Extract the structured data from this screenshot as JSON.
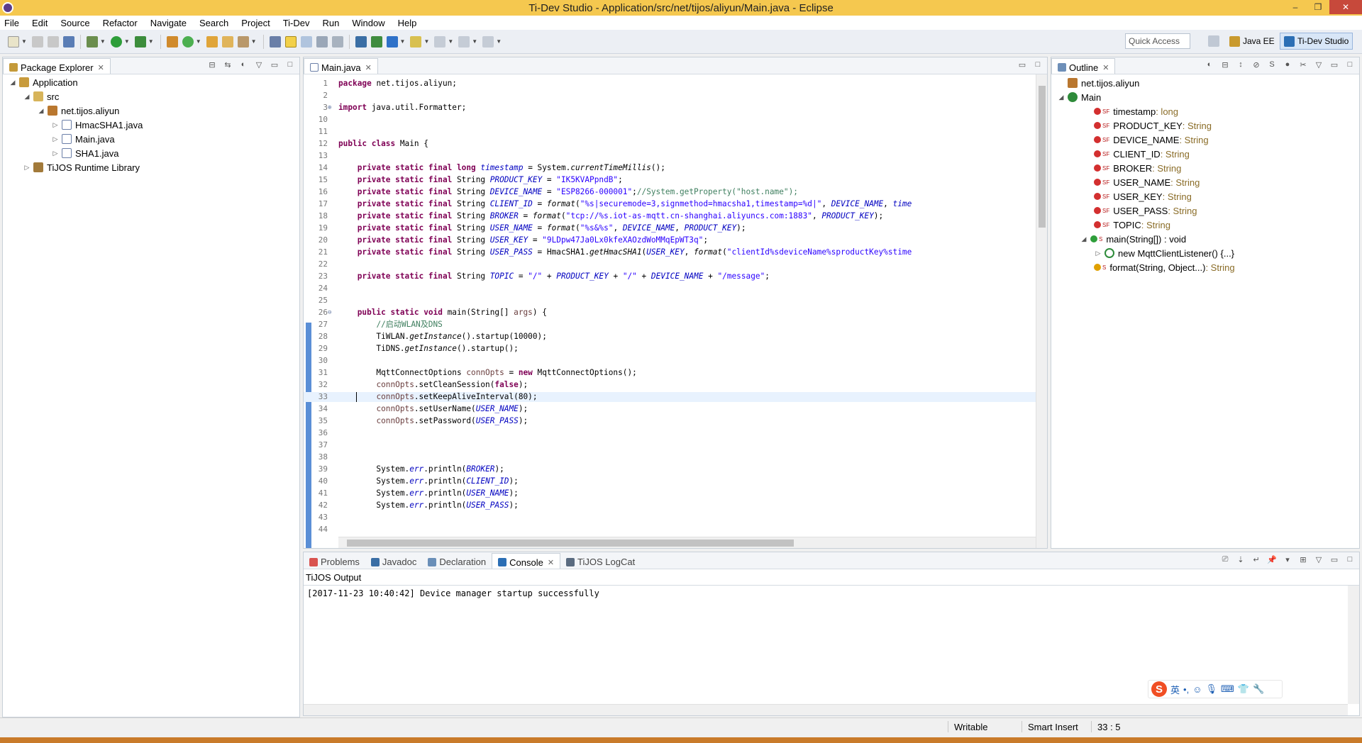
{
  "window": {
    "title": "Ti-Dev Studio - Application/src/net/tijos/aliyun/Main.java - Eclipse",
    "minimize": "–",
    "maximize": "❐",
    "close": "✕"
  },
  "menu": [
    "File",
    "Edit",
    "Source",
    "Refactor",
    "Navigate",
    "Search",
    "Project",
    "Ti-Dev",
    "Run",
    "Window",
    "Help"
  ],
  "toolbar": {
    "quick_access": "Quick Access",
    "perspectives": [
      "Java EE",
      "Ti-Dev Studio"
    ]
  },
  "package_explorer": {
    "tab": "Package Explorer",
    "items": [
      {
        "label": "Application",
        "expanded": true,
        "icon": "project-icon"
      },
      {
        "label": "src",
        "expanded": true,
        "icon": "source-folder-icon"
      },
      {
        "label": "net.tijos.aliyun",
        "expanded": true,
        "icon": "package-icon"
      },
      {
        "label": "HmacSHA1.java",
        "expanded": false,
        "icon": "java-file-icon"
      },
      {
        "label": "Main.java",
        "expanded": false,
        "icon": "java-file-icon"
      },
      {
        "label": "SHA1.java",
        "expanded": false,
        "icon": "java-file-icon"
      },
      {
        "label": "TiJOS Runtime Library",
        "expanded": false,
        "icon": "library-icon"
      }
    ]
  },
  "editor": {
    "tab": "Main.java",
    "cursor_line": "33",
    "lines": [
      {
        "n": "1",
        "html": "<span class=\"kw\">package</span> net.tijos.aliyun;"
      },
      {
        "n": "2",
        "html": ""
      },
      {
        "n": "3",
        "html": "<span class=\"kw\">import</span> java.util.Formatter;",
        "fold": "⊕"
      },
      {
        "n": "10",
        "html": ""
      },
      {
        "n": "11",
        "html": ""
      },
      {
        "n": "12",
        "html": "<span class=\"kw\">public class</span> Main {"
      },
      {
        "n": "13",
        "html": ""
      },
      {
        "n": "14",
        "html": "    <span class=\"kw\">private static final long</span> <span class=\"fld\">timestamp</span> = System.<span class=\"mi\">currentTimeMillis</span>();"
      },
      {
        "n": "15",
        "html": "    <span class=\"kw\">private static final</span> String <span class=\"fld\">PRODUCT_KEY</span> = <span class=\"str\">\"IK5KVAPpndB\"</span>;"
      },
      {
        "n": "16",
        "html": "    <span class=\"kw\">private static final</span> String <span class=\"fld\">DEVICE_NAME</span> = <span class=\"str\">\"ESP8266-000001\"</span>;<span class=\"cmt\">//System.getProperty(\"host.name\");</span>"
      },
      {
        "n": "17",
        "html": "    <span class=\"kw\">private static final</span> String <span class=\"fld\">CLIENT_ID</span> = <span class=\"mi\">format</span>(<span class=\"str\">\"%s|securemode=3,signmethod=hmacsha1,timestamp=%d|\"</span>, <span class=\"fld\">DEVICE_NAME</span>, <span class=\"fld\">time</span>"
      },
      {
        "n": "18",
        "html": "    <span class=\"kw\">private static final</span> String <span class=\"fld\">BROKER</span> = <span class=\"mi\">format</span>(<span class=\"str\">\"tcp://%s.iot-as-mqtt.cn-shanghai.aliyuncs.com:1883\"</span>, <span class=\"fld\">PRODUCT_KEY</span>);"
      },
      {
        "n": "19",
        "html": "    <span class=\"kw\">private static final</span> String <span class=\"fld\">USER_NAME</span> = <span class=\"mi\">format</span>(<span class=\"str\">\"%s&amp;%s\"</span>, <span class=\"fld\">DEVICE_NAME</span>, <span class=\"fld\">PRODUCT_KEY</span>);"
      },
      {
        "n": "20",
        "html": "    <span class=\"kw\">private static final</span> String <span class=\"fld\">USER_KEY</span> = <span class=\"str\">\"9LDpw47Ja0Lx0kfeXAOzdWoMMqEpWT3q\"</span>;"
      },
      {
        "n": "21",
        "html": "    <span class=\"kw\">private static final</span> String <span class=\"fld\">USER_PASS</span> = HmacSHA1.<span class=\"mi\">getHmacSHA1</span>(<span class=\"fld\">USER_KEY</span>, <span class=\"mi\">format</span>(<span class=\"str\">\"clientId%sdeviceName%sproductKey%stime</span>"
      },
      {
        "n": "22",
        "html": ""
      },
      {
        "n": "23",
        "html": "    <span class=\"kw\">private static final</span> String <span class=\"fld\">TOPIC</span> = <span class=\"str\">\"/\"</span> + <span class=\"fld\">PRODUCT_KEY</span> + <span class=\"str\">\"/\"</span> + <span class=\"fld\">DEVICE_NAME</span> + <span class=\"str\">\"/message\"</span>;"
      },
      {
        "n": "24",
        "html": ""
      },
      {
        "n": "25",
        "html": ""
      },
      {
        "n": "26",
        "html": "    <span class=\"kw\">public static void</span> main(String[] <span class=\"var\">args</span>) {",
        "fold": "⊖"
      },
      {
        "n": "27",
        "html": "        <span class=\"cmt\">//启动WLAN及DNS</span>"
      },
      {
        "n": "28",
        "html": "        TiWLAN.<span class=\"mi\">getInstance</span>().startup(10000);"
      },
      {
        "n": "29",
        "html": "        TiDNS.<span class=\"mi\">getInstance</span>().startup();"
      },
      {
        "n": "30",
        "html": ""
      },
      {
        "n": "31",
        "html": "        MqttConnectOptions <span class=\"var\">connOpts</span> = <span class=\"kw\">new</span> MqttConnectOptions();"
      },
      {
        "n": "32",
        "html": "        <span class=\"var\">connOpts</span>.setCleanSession(<span class=\"kw\">false</span>);"
      },
      {
        "n": "33",
        "html": "        <span class=\"var\">connOpts</span>.setKeepAliveInterval(80);"
      },
      {
        "n": "34",
        "html": "        <span class=\"var\">connOpts</span>.setUserName(<span class=\"fld\">USER_NAME</span>);"
      },
      {
        "n": "35",
        "html": "        <span class=\"var\">connOpts</span>.setPassword(<span class=\"fld\">USER_PASS</span>);"
      },
      {
        "n": "36",
        "html": ""
      },
      {
        "n": "37",
        "html": ""
      },
      {
        "n": "38",
        "html": ""
      },
      {
        "n": "39",
        "html": "        System.<span class=\"fld\">err</span>.println(<span class=\"fld\">BROKER</span>);"
      },
      {
        "n": "40",
        "html": "        System.<span class=\"fld\">err</span>.println(<span class=\"fld\">CLIENT_ID</span>);"
      },
      {
        "n": "41",
        "html": "        System.<span class=\"fld\">err</span>.println(<span class=\"fld\">USER_NAME</span>);"
      },
      {
        "n": "42",
        "html": "        System.<span class=\"fld\">err</span>.println(<span class=\"fld\">USER_PASS</span>);"
      },
      {
        "n": "43",
        "html": ""
      },
      {
        "n": "44",
        "html": ""
      }
    ]
  },
  "outline": {
    "tab": "Outline",
    "package": "net.tijos.aliyun",
    "class": "Main",
    "fields": [
      {
        "name": "timestamp",
        "type": " : long"
      },
      {
        "name": "PRODUCT_KEY",
        "type": " : String"
      },
      {
        "name": "DEVICE_NAME",
        "type": " : String"
      },
      {
        "name": "CLIENT_ID",
        "type": " : String"
      },
      {
        "name": "BROKER",
        "type": " : String"
      },
      {
        "name": "USER_NAME",
        "type": " : String"
      },
      {
        "name": "USER_KEY",
        "type": " : String"
      },
      {
        "name": "USER_PASS",
        "type": " : String"
      },
      {
        "name": "TOPIC",
        "type": " : String"
      }
    ],
    "main_method": "main(String[]) : void",
    "listener": "new MqttClientListener() {...}",
    "format_method": "format(String, Object...)",
    "format_type": " : String"
  },
  "bottom": {
    "tabs": [
      "Problems",
      "Javadoc",
      "Declaration",
      "Console",
      "TiJOS LogCat"
    ],
    "active_tab": "Console",
    "console_title": "TiJOS Output",
    "console_lines": [
      "[2017-11-23 10:40:42] Device manager startup successfully"
    ]
  },
  "ime": {
    "mode": "英"
  },
  "status": {
    "writable": "Writable",
    "insert": "Smart Insert",
    "position": "33 : 5"
  }
}
